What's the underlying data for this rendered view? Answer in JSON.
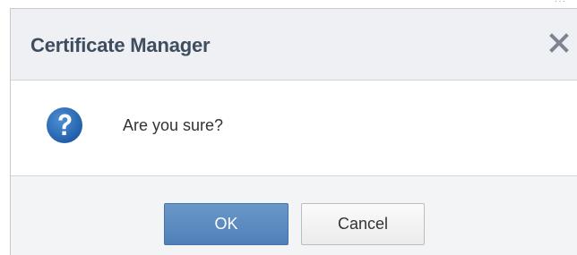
{
  "dialog": {
    "title": "Certificate Manager",
    "message": "Are you sure?",
    "icons": {
      "close": "close-icon",
      "question": "question-icon"
    },
    "buttons": {
      "ok_label": "OK",
      "cancel_label": "Cancel"
    }
  },
  "colors": {
    "title_text": "#3e4d5f",
    "header_background": "#eef0f3",
    "icon_blue": "#2f6eb5",
    "ok_button": "#5b89c0",
    "footer_background": "#f3f4f6"
  }
}
